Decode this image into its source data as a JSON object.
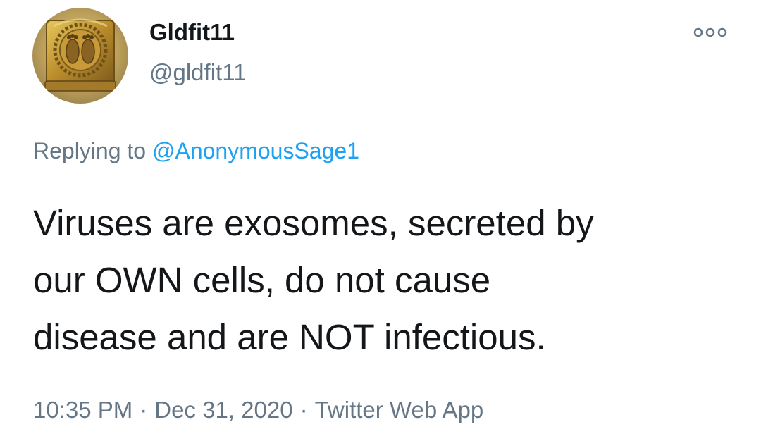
{
  "user": {
    "display_name": "Gldfit11",
    "handle": "@gldfit11",
    "avatar_icon": "golden-footprints-plaque-avatar"
  },
  "more_menu": {
    "icon": "more-dots-icon"
  },
  "reply": {
    "prefix": "Replying to ",
    "mention": "@AnonymousSage1",
    "mention_color": "#1da1f2"
  },
  "tweet": {
    "text": "Viruses are exosomes, secreted by\nour OWN cells, do not cause\ndisease and are NOT infectious."
  },
  "meta": {
    "time": "10:35 PM",
    "separator": "·",
    "date": "Dec 31, 2020",
    "source": "Twitter Web App"
  },
  "colors": {
    "text": "#14171a",
    "secondary": "#657786",
    "link": "#1da1f2"
  }
}
